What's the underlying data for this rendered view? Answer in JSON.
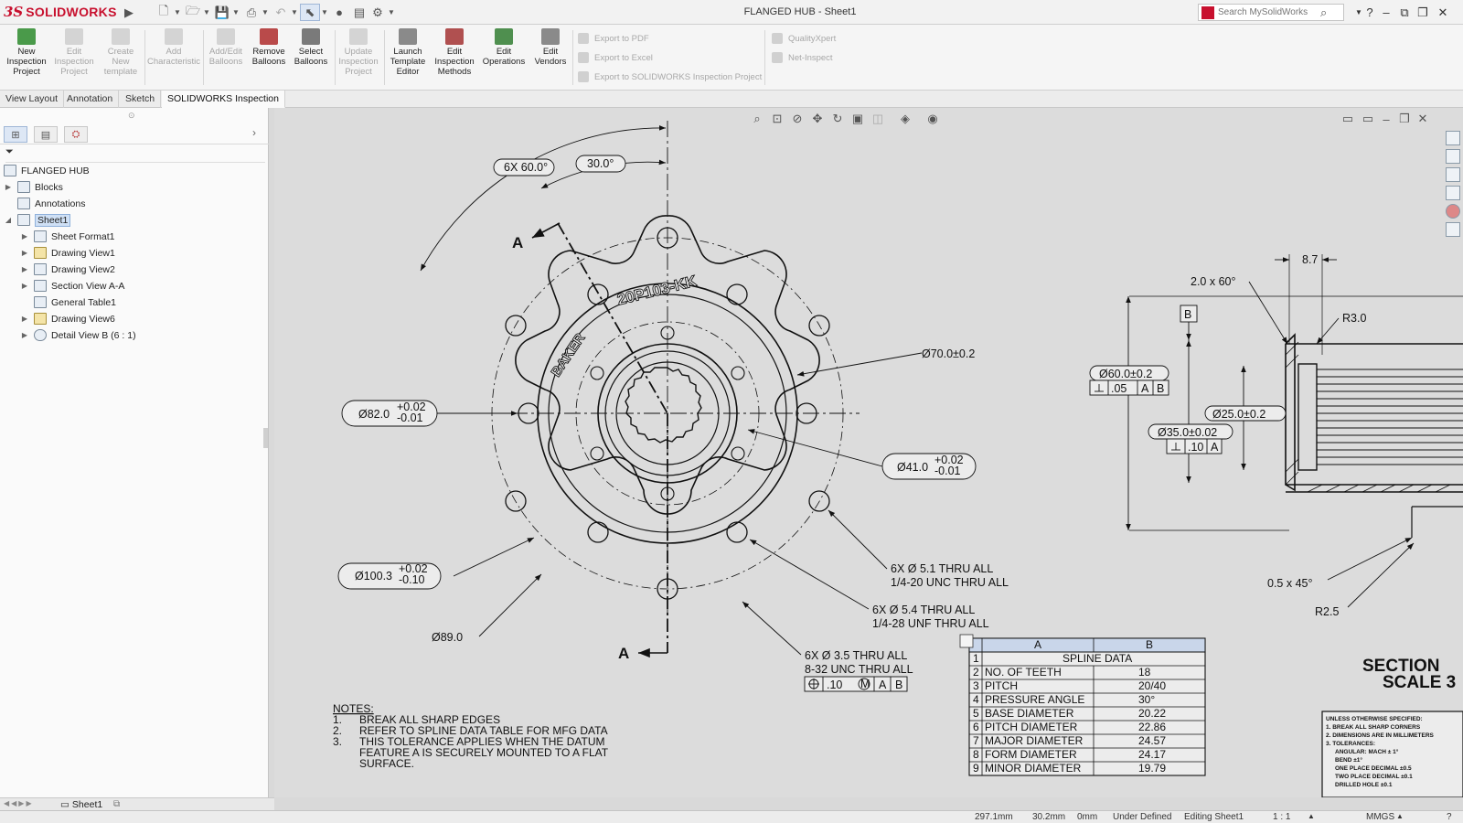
{
  "app": {
    "brand_ds": "3S",
    "brand_name": "SOLIDWORKS",
    "doc_title": "FLANGED HUB - Sheet1"
  },
  "search": {
    "placeholder": "Search MySolidWorks"
  },
  "ribbon": {
    "new_inspection_project": "New Inspection Project",
    "edit_inspection_project": "Edit Inspection Project",
    "create_new_template": "Create New template",
    "add_characteristic": "Add Characteristic",
    "add_edit_balloons": "Add/Edit Balloons",
    "remove_balloons": "Remove Balloons",
    "select_balloons": "Select Balloons",
    "update_inspection_project": "Update Inspection Project",
    "launch_template_editor": "Launch Template Editor",
    "edit_inspection_methods": "Edit Inspection Methods",
    "edit_operations": "Edit Operations",
    "edit_vendors": "Edit Vendors",
    "export_pdf": "Export to PDF",
    "export_excel": "Export to Excel",
    "export_inspection_project": "Export to SOLIDWORKS Inspection Project",
    "quality_xpert": "QualityXpert",
    "net_inspect": "Net-Inspect"
  },
  "tabs": [
    "View Layout",
    "Annotation",
    "Sketch",
    "SOLIDWORKS Inspection"
  ],
  "tree": {
    "root": "FLANGED HUB",
    "items": [
      "Blocks",
      "Annotations",
      "Sheet1",
      "Sheet Format1",
      "Drawing View1",
      "Drawing View2",
      "Section View A-A",
      "General Table1",
      "Drawing View6",
      "Detail View B (6 : 1)"
    ]
  },
  "sheet_tab": "Sheet1",
  "drawing": {
    "engraving_top": "20P103-KK",
    "engraving_side": "BAKER",
    "section_letter": "A",
    "dims": {
      "d_6x60": "6X 60.0°",
      "d_30": "30.0°",
      "d_82": "Ø82.0",
      "d_82_tol_plus": "+0.02",
      "d_82_tol_minus": "-0.01",
      "d_70": "Ø70.0±0.2",
      "d_41": "Ø41.0",
      "d_41_tol_plus": "+0.02",
      "d_41_tol_minus": "-0.01",
      "d_100": "Ø100.3",
      "d_100_tol_plus": "+0.02",
      "d_100_tol_minus": "-0.10",
      "d_89": "Ø89.0",
      "hole1_a": "6X Ø 5.1 THRU ALL",
      "hole1_b": "1/4-20 UNC  THRU ALL",
      "hole2_a": "6X Ø 5.4 THRU ALL",
      "hole2_b": "1/4-28 UNF  THRU ALL",
      "hole3_a": "6X Ø 3.5 THRU ALL",
      "hole3_b": "8-32 UNC  THRU ALL",
      "fcf_pos": ".10",
      "fcf_m": "M",
      "fcf_a": "A",
      "fcf_b": "B",
      "sec_87": "8.7",
      "sec_chamfer": "2.0 x 60°",
      "sec_r3": "R3.0",
      "sec_datum_b": "B",
      "sec_60": "Ø60.0±0.2",
      "sec_05": ".05",
      "sec_25": "Ø25.0±0.2",
      "sec_35": "Ø35.0±0.02",
      "sec_10": ".10",
      "sec_chamfer2": "0.5 x 45°",
      "sec_r25": "R2.5"
    },
    "section_title_1": "SECTION",
    "section_title_2": "SCALE 3",
    "notes": {
      "title": "NOTES:",
      "items": [
        {
          "n": "1.",
          "lines": [
            "BREAK ALL SHARP EDGES"
          ]
        },
        {
          "n": "2.",
          "lines": [
            "REFER TO SPLINE DATA TABLE FOR MFG DATA"
          ]
        },
        {
          "n": "3.",
          "lines": [
            "THIS TOLERANCE APPLIES WHEN THE DATUM",
            "FEATURE A IS SECURELY MOUNTED TO A FLAT",
            "SURFACE."
          ]
        }
      ]
    },
    "spline_table": {
      "col_a": "A",
      "col_b": "B",
      "title": "SPLINE DATA",
      "rows": [
        [
          "NO. OF TEETH",
          "18"
        ],
        [
          "PITCH",
          "20/40"
        ],
        [
          "PRESSURE ANGLE",
          "30°"
        ],
        [
          "BASE DIAMETER",
          "20.22"
        ],
        [
          "PITCH DIAMETER",
          "22.86"
        ],
        [
          "MAJOR DIAMETER",
          "24.57"
        ],
        [
          "FORM DIAMETER",
          "24.17"
        ],
        [
          "MINOR DIAMETER",
          "19.79"
        ]
      ]
    },
    "title_block_lines": [
      "UNLESS OTHERWISE SPECIFIED:",
      "1. BREAK ALL SHARP CORNERS",
      "2. DIMENSIONS ARE IN MILLIMETERS",
      "3. TOLERANCES:",
      "ANGULAR: MACH ±  1°",
      "BEND ±1°",
      "ONE PLACE DECIMAL   ±0.5",
      "TWO PLACE DECIMAL   ±0.1",
      "DRILLED HOLE         ±0.1"
    ]
  },
  "status": {
    "x": "297.1mm",
    "y": "30.2mm",
    "z": "0mm",
    "state": "Under Defined",
    "editing": "Editing Sheet1",
    "scale": "1 : 1",
    "units": "MMGS"
  },
  "colors": {
    "brand": "#c8102e",
    "selection": "#cfe0f5",
    "canvas": "#dcdcdc"
  }
}
